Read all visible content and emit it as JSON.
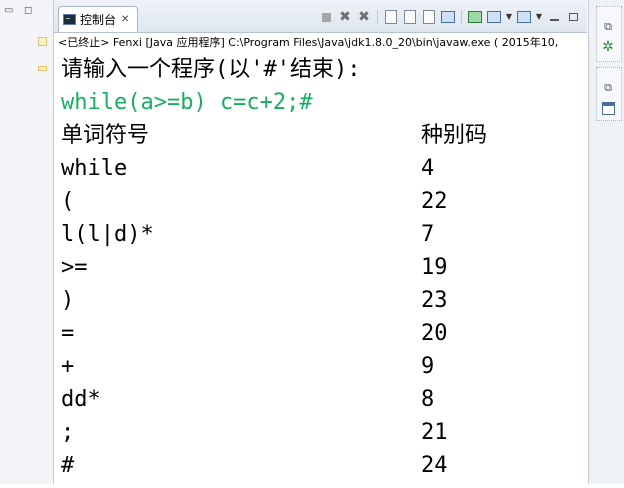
{
  "left_strip": {
    "minimize_icon": "▭",
    "maximize_icon": "◻"
  },
  "tab": {
    "label": "控制台",
    "close": "✕"
  },
  "toolbar": {
    "icons": [
      "stop-icon",
      "remove-launch-icon",
      "remove-all-icon",
      "clear-console-icon",
      "scroll-lock-icon",
      "word-wrap-icon",
      "pin-console-icon",
      "display-selected-console-icon",
      "open-console-icon",
      "minimize-icon",
      "maximize-icon"
    ]
  },
  "status_line": "<已终止> Fenxi [Java 应用程序] C:\\Program Files\\Java\\jdk1.8.0_20\\bin\\javaw.exe ( 2015年10,",
  "console": {
    "prompt": "请输入一个程序(以'#'结束):",
    "input": "while(a>=b) c=c+2;#",
    "header": {
      "word": "单词符号",
      "code": "种别码"
    },
    "rows": [
      {
        "word": "while",
        "code": "4"
      },
      {
        "word": "(",
        "code": "22"
      },
      {
        "word": "l(l|d)*",
        "code": "7"
      },
      {
        "word": ">=",
        "code": "19"
      },
      {
        "word": ")",
        "code": "23"
      },
      {
        "word": "=",
        "code": "20"
      },
      {
        "word": "+",
        "code": "9"
      },
      {
        "word": "dd*",
        "code": "8"
      },
      {
        "word": ";",
        "code": "21"
      },
      {
        "word": "#",
        "code": "24"
      }
    ]
  },
  "colors": {
    "input_echo": "#16b060",
    "text": "#000000"
  },
  "right_strip": {
    "icons": [
      "restore-icon",
      "debug-gear-icon",
      "restore-icon",
      "panel-icon"
    ]
  }
}
